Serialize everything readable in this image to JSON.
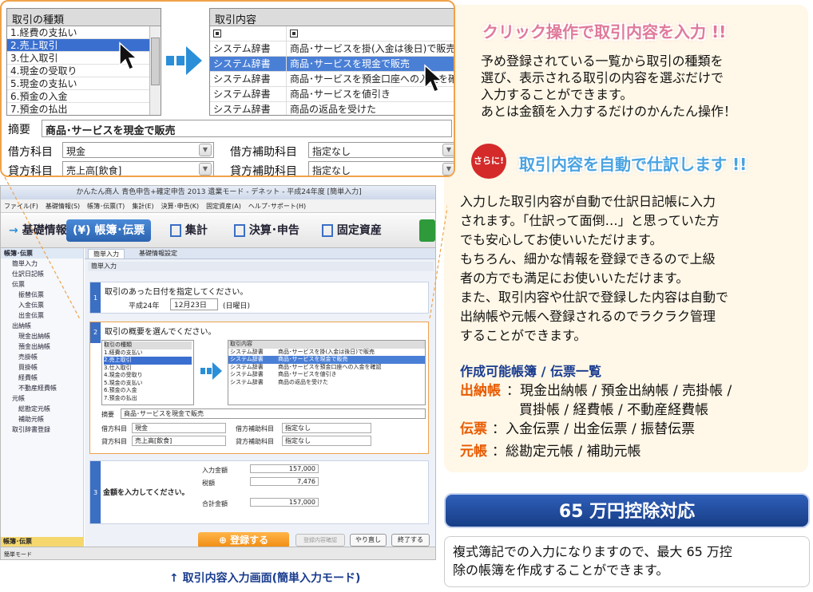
{
  "zoom": {
    "types_header": "取引の種類",
    "types": [
      "1.経費の支払い",
      "2.売上取引",
      "3.仕入取引",
      "4.現金の受取り",
      "5.現金の支払い",
      "6.預金の入金",
      "7.預金の払出"
    ],
    "content_header": "取引内容",
    "contents": [
      {
        "source": "システム辞書",
        "desc": "商品･サービスを掛(入金は後日)で販売"
      },
      {
        "source": "システム辞書",
        "desc": "商品･サービスを現金で販売"
      },
      {
        "source": "システム辞書",
        "desc": "商品･サービスを預金口座への入金を確認"
      },
      {
        "source": "システム辞書",
        "desc": "商品･サービスを値引き"
      },
      {
        "source": "システム辞書",
        "desc": "商品の返品を受けた"
      }
    ],
    "summary_label": "摘要",
    "summary_value": "商品･サービスを現金で販売",
    "debit_label": "借方科目",
    "debit_value": "現金",
    "debit_sub_label": "借方補助科目",
    "debit_sub_value": "指定なし",
    "credit_label": "貸方科目",
    "credit_value": "売上高[飲食]",
    "credit_sub_label": "貸方補助科目",
    "credit_sub_value": "指定なし"
  },
  "app": {
    "title": "かんたん商人 青色申告+確定申告 2013 遺業モード - デネット - 平成24年度 [簡単入力]",
    "menu": [
      "ファイル(F)",
      "基礎情報(S)",
      "帳簿･伝票(T)",
      "集計(E)",
      "決算･申告(K)",
      "固定資産(A)",
      "ヘルプ･サポート(H)"
    ],
    "nav": [
      "基礎情報",
      "帳簿･伝票",
      "集計",
      "決算･申告",
      "固定資産"
    ],
    "sidebar": [
      {
        "label": "帳簿･伝票",
        "kind": "grp"
      },
      {
        "label": "簡単入力",
        "kind": "item"
      },
      {
        "label": "仕訳日記帳",
        "kind": "item"
      },
      {
        "label": "伝票",
        "kind": "item"
      },
      {
        "label": "振替伝票",
        "kind": "sub"
      },
      {
        "label": "入金伝票",
        "kind": "sub"
      },
      {
        "label": "出金伝票",
        "kind": "sub"
      },
      {
        "label": "出納帳",
        "kind": "item"
      },
      {
        "label": "現金出納帳",
        "kind": "sub"
      },
      {
        "label": "預金出納帳",
        "kind": "sub"
      },
      {
        "label": "売掛帳",
        "kind": "sub"
      },
      {
        "label": "買掛帳",
        "kind": "sub"
      },
      {
        "label": "経費帳",
        "kind": "sub"
      },
      {
        "label": "不動産経費帳",
        "kind": "sub"
      },
      {
        "label": "元帳",
        "kind": "item"
      },
      {
        "label": "総勘定元帳",
        "kind": "sub"
      },
      {
        "label": "補助元帳",
        "kind": "sub"
      },
      {
        "label": "取引辞書登録",
        "kind": "item"
      }
    ],
    "tabs": [
      "簡単入力",
      "基礎情報設定"
    ],
    "panel_title": "簡単入力",
    "step1_title": "取引のあった日付を指定してください。",
    "date_era": "平成24年",
    "date_value": "12月23日",
    "date_weekday": "(日曜日)",
    "step2_title": "取引の概要を選んでください。",
    "step3_title": "金額を入力してください。",
    "amount_labels": [
      "入力金額",
      "税額",
      "合計金額"
    ],
    "amount_values": [
      "157,000",
      "7,476",
      "157,000"
    ],
    "register_button": "登録する",
    "confirm_button": "登録内容確認",
    "redo_button": "やり直し",
    "finish_button": "終了する",
    "sidebar_footer": "帳簿･伝票",
    "status": "簡単モード"
  },
  "right": {
    "head1": "クリック操作で取引内容を入力 !!",
    "para1": [
      "予め登録されている一覧から取引の種類を",
      "選び、表示される取引の内容を選ぶだけで",
      "入力することができます。",
      "あとは金額を入力するだけのかんたん操作！"
    ],
    "badge": "さらに!",
    "head2": "取引内容を自動で仕訳します !!",
    "para2": [
      "入力した取引内容が自動で仕訳日記帳に入力",
      "されます。「仕訳って面倒…」と思っていた方",
      "でも安心してお使いいただけます。",
      "もちろん、細かな情報を登録できるので上級",
      "者の方でも満足にお使いいただけます。",
      "また、取引内容や仕訳で登録した内容は自動で",
      "出納帳や元帳へ登録されるのでラクラク管理",
      "することができます。"
    ],
    "list_title": "作成可能帳簿 / 伝票一覧",
    "list": [
      {
        "label": "出納帳",
        "items": "：現金出納帳 / 預金出納帳 / 売掛帳 /",
        "cont": "買掛帳 / 経費帳 / 不動産経費帳"
      },
      {
        "label": "伝票",
        "items": "：入金伝票 / 出金伝票 / 振替伝票",
        "cont": ""
      },
      {
        "label": "元帳",
        "items": "：総勘定元帳 / 補助元帳",
        "cont": ""
      }
    ],
    "box65": "65 万円控除対応",
    "note": [
      "複式簿記での入力になりますので、最大 65 万控",
      "除の帳簿を作成することができます。"
    ]
  },
  "caption": "↑ 取引内容入力画面(簡単入力モード)",
  "colors": {
    "accent_orange": "#f0a24a",
    "brand_blue": "#2c64b0",
    "label_orange": "#e85a00"
  }
}
